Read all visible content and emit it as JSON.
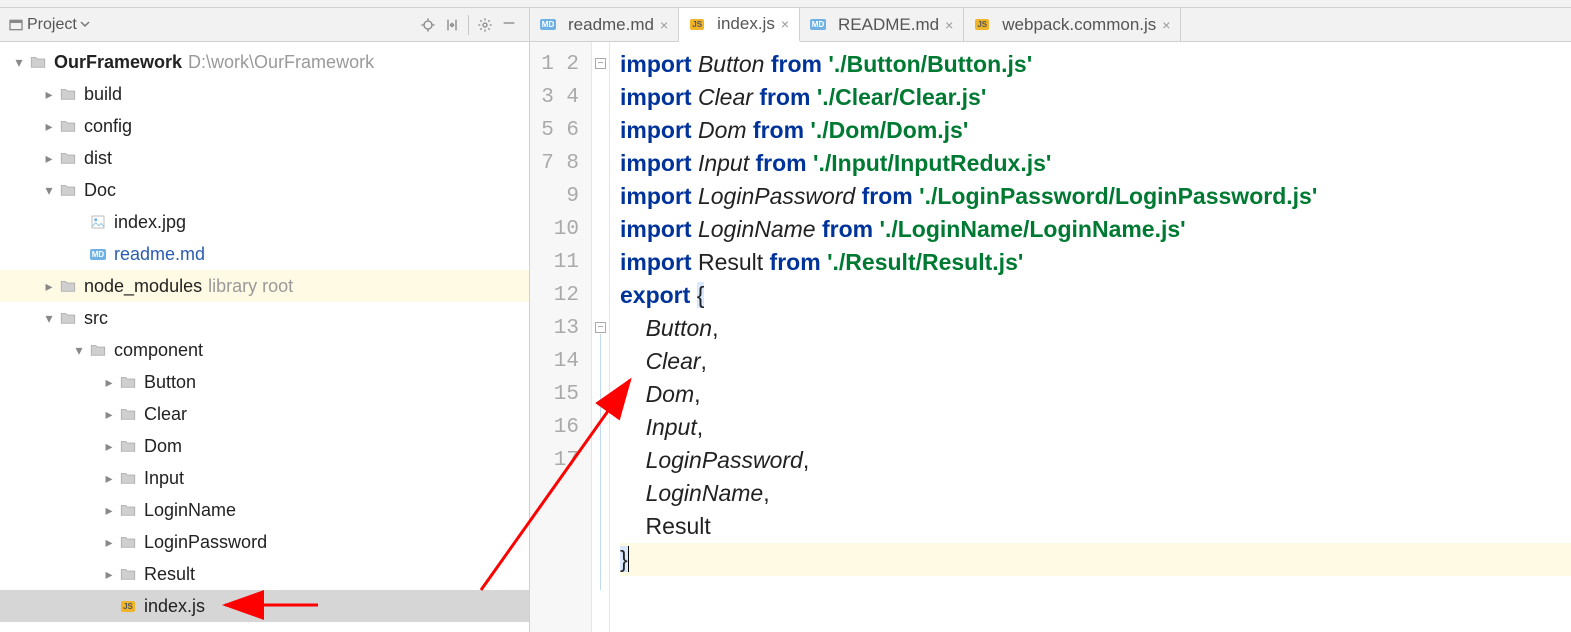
{
  "panel": {
    "title": "Project",
    "toolbar_icons": [
      "target-icon",
      "collapse-icon",
      "gear-icon",
      "hide-icon"
    ]
  },
  "tree": {
    "root": {
      "name": "OurFramework",
      "path": "D:\\work\\OurFramework"
    },
    "items": [
      {
        "d": 0,
        "chev": "down",
        "icon": "folder",
        "label": "OurFramework",
        "bold": true,
        "path": "D:\\work\\OurFramework"
      },
      {
        "d": 1,
        "chev": "right",
        "icon": "folder",
        "label": "build"
      },
      {
        "d": 1,
        "chev": "right",
        "icon": "folder",
        "label": "config"
      },
      {
        "d": 1,
        "chev": "right",
        "icon": "folder",
        "label": "dist"
      },
      {
        "d": 1,
        "chev": "down",
        "icon": "folder",
        "label": "Doc"
      },
      {
        "d": 2,
        "chev": "none",
        "icon": "img",
        "label": "index.jpg"
      },
      {
        "d": 2,
        "chev": "none",
        "icon": "md",
        "label": "readme.md",
        "blue": true
      },
      {
        "d": 1,
        "chev": "right",
        "icon": "folder",
        "label": "node_modules",
        "suffix": "library root",
        "lib": true
      },
      {
        "d": 1,
        "chev": "down",
        "icon": "folder",
        "label": "src"
      },
      {
        "d": 2,
        "chev": "down",
        "icon": "folder",
        "label": "component"
      },
      {
        "d": 3,
        "chev": "right",
        "icon": "folder",
        "label": "Button"
      },
      {
        "d": 3,
        "chev": "right",
        "icon": "folder",
        "label": "Clear"
      },
      {
        "d": 3,
        "chev": "right",
        "icon": "folder",
        "label": "Dom"
      },
      {
        "d": 3,
        "chev": "right",
        "icon": "folder",
        "label": "Input"
      },
      {
        "d": 3,
        "chev": "right",
        "icon": "folder",
        "label": "LoginName"
      },
      {
        "d": 3,
        "chev": "right",
        "icon": "folder",
        "label": "LoginPassword"
      },
      {
        "d": 3,
        "chev": "right",
        "icon": "folder",
        "label": "Result"
      },
      {
        "d": 3,
        "chev": "none",
        "icon": "js",
        "label": "index.js",
        "sel": true
      }
    ]
  },
  "tabs": [
    {
      "icon": "md",
      "label": "readme.md",
      "active": false
    },
    {
      "icon": "js",
      "label": "index.js",
      "active": true
    },
    {
      "icon": "md",
      "label": "README.md",
      "active": false
    },
    {
      "icon": "js",
      "label": "webpack.common.js",
      "active": false
    }
  ],
  "code": {
    "lines": [
      [
        [
          "kw",
          "import"
        ],
        [
          "",
          " "
        ],
        [
          "it",
          "Button"
        ],
        [
          "",
          " "
        ],
        [
          "kw",
          "from"
        ],
        [
          "",
          " "
        ],
        [
          "str",
          "'./Button/Button.js'"
        ]
      ],
      [
        [
          "kw",
          "import"
        ],
        [
          "",
          " "
        ],
        [
          "it",
          "Clear"
        ],
        [
          "",
          " "
        ],
        [
          "kw",
          "from"
        ],
        [
          "",
          " "
        ],
        [
          "str",
          "'./Clear/Clear.js'"
        ]
      ],
      [
        [
          "kw",
          "import"
        ],
        [
          "",
          " "
        ],
        [
          "it",
          "Dom"
        ],
        [
          "",
          " "
        ],
        [
          "kw",
          "from"
        ],
        [
          "",
          " "
        ],
        [
          "str",
          "'./Dom/Dom.js'"
        ]
      ],
      [
        [
          "kw",
          "import"
        ],
        [
          "",
          " "
        ],
        [
          "it",
          "Input"
        ],
        [
          "",
          " "
        ],
        [
          "kw",
          "from"
        ],
        [
          "",
          " "
        ],
        [
          "str",
          "'./Input/InputRedux.js'"
        ]
      ],
      [
        [
          "kw",
          "import"
        ],
        [
          "",
          " "
        ],
        [
          "it",
          "LoginPassword"
        ],
        [
          "",
          " "
        ],
        [
          "kw",
          "from"
        ],
        [
          "",
          " "
        ],
        [
          "str",
          "'./LoginPassword/LoginPassword.js'"
        ]
      ],
      [
        [
          "kw",
          "import"
        ],
        [
          "",
          " "
        ],
        [
          "it",
          "LoginName"
        ],
        [
          "",
          " "
        ],
        [
          "kw",
          "from"
        ],
        [
          "",
          " "
        ],
        [
          "str",
          "'./LoginName/LoginName.js'"
        ]
      ],
      [
        [
          "kw",
          "import"
        ],
        [
          "",
          " Result "
        ],
        [
          "kw",
          "from"
        ],
        [
          "",
          " "
        ],
        [
          "str",
          "'./Result/Result.js'"
        ]
      ],
      [
        [
          "",
          ""
        ]
      ],
      [
        [
          "kw",
          "export"
        ],
        [
          "",
          " "
        ],
        [
          "brace-hl",
          "{"
        ]
      ],
      [
        [
          "",
          "    "
        ],
        [
          "it",
          "Button"
        ],
        [
          "",
          ","
        ]
      ],
      [
        [
          "",
          "    "
        ],
        [
          "it",
          "Clear"
        ],
        [
          "",
          ","
        ]
      ],
      [
        [
          "",
          "    "
        ],
        [
          "it",
          "Dom"
        ],
        [
          "",
          ","
        ]
      ],
      [
        [
          "",
          "    "
        ],
        [
          "it",
          "Input"
        ],
        [
          "",
          ","
        ]
      ],
      [
        [
          "",
          "    "
        ],
        [
          "it",
          "LoginPassword"
        ],
        [
          "",
          ","
        ]
      ],
      [
        [
          "",
          "    "
        ],
        [
          "it",
          "LoginName"
        ],
        [
          "",
          ","
        ]
      ],
      [
        [
          "",
          "    Result"
        ]
      ],
      [
        [
          "line-hl",
          ""
        ],
        [
          "brace-hl",
          "}"
        ],
        [
          "caret",
          ""
        ]
      ]
    ],
    "fold_marks": [
      1,
      9
    ],
    "vline_from": 9,
    "vline_to": 17
  }
}
